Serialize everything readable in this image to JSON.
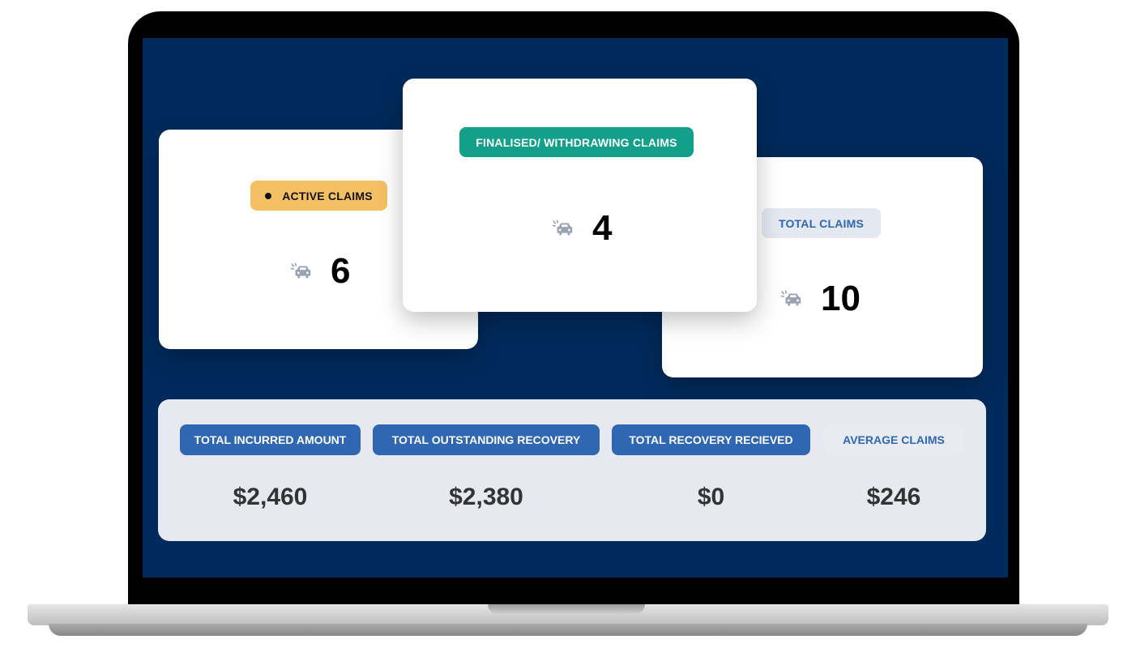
{
  "colors": {
    "screen_bg": "#002a5c",
    "active": "#f5c063",
    "finalised": "#12a08a",
    "total": "#e3e8f1",
    "metric": "#2f67b2"
  },
  "cards": [
    {
      "label": "ACTIVE CLAIMS",
      "value": "6",
      "icon": "car-crash-icon",
      "dot": true
    },
    {
      "label": "FINALISED/ WITHDRAWING CLAIMS",
      "value": "4",
      "icon": "car-crash-icon"
    },
    {
      "label": "TOTAL CLAIMS",
      "value": "10",
      "icon": "car-crash-icon"
    }
  ],
  "metrics": [
    {
      "label": "TOTAL INCURRED AMOUNT",
      "value": "$2,460"
    },
    {
      "label": "TOTAL OUTSTANDING RECOVERY",
      "value": "$2,380"
    },
    {
      "label": "TOTAL RECOVERY RECIEVED",
      "value": "$0"
    },
    {
      "label": "AVERAGE CLAIMS",
      "value": "$246"
    }
  ]
}
